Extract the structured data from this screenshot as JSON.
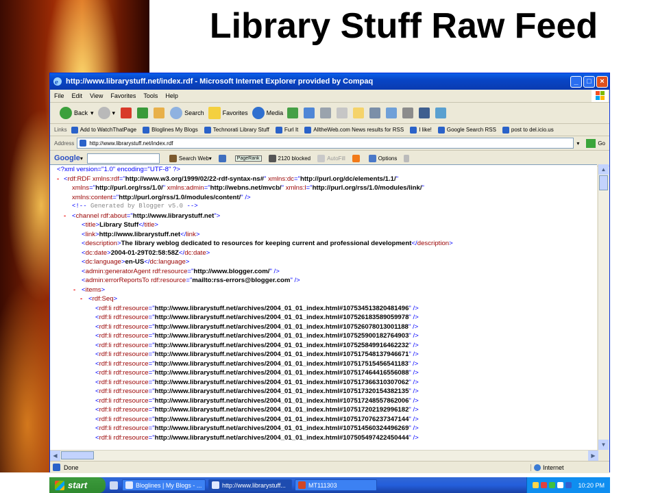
{
  "slide": {
    "title": "Library Stuff Raw Feed"
  },
  "browser": {
    "title": "http://www.librarystuff.net/index.rdf - Microsoft Internet Explorer provided by Compaq",
    "menu": [
      "File",
      "Edit",
      "View",
      "Favorites",
      "Tools",
      "Help"
    ],
    "toolbar": {
      "back": "Back",
      "search": "Search",
      "favorites": "Favorites",
      "media": "Media"
    },
    "links_label": "Links",
    "links": [
      "Add to WatchThatPage",
      "Bloglines My Blogs",
      "Technorati Library Stuff",
      "Furl It",
      "AlltheWeb.com News results for RSS",
      "I like!",
      "Google Search RSS",
      "post to del.icio.us"
    ],
    "address_label": "Address",
    "address": "http://www.librarystuff.net/index.rdf",
    "go_label": "Go",
    "google": {
      "logo": "Google",
      "search_web": "Search Web",
      "pagerank": "PageRank",
      "blocked": "2120 blocked",
      "autofill": "AutoFill",
      "options": "Options"
    },
    "status": {
      "text": "Done",
      "zone": "Internet"
    }
  },
  "xml": {
    "decl": "<?xml version=\"1.0\" encoding=\"UTF-8\" ?>",
    "rdf_ns1": "http://www.w3.org/1999/02/22-rdf-syntax-ns#",
    "dc_ns": "http://purl.org/dc/elements/1.1/",
    "rss_ns": "http://purl.org/rss/1.0/",
    "admin_ns": "http://webns.net/mvcb/",
    "link_ns": "http://purl.org/rss/1.0/modules/link/",
    "content_ns": "http://purl.org/rss/1.0/modules/content/",
    "comment": "Generated by Blogger v5.0",
    "channel_about": "http://www.librarystuff.net",
    "title": "Library Stuff",
    "link": "http://www.librarystuff.net",
    "description": "The library weblog dedicated to resources for keeping current and professional development",
    "date": "2004-01-29T02:58:58Z",
    "language": "en-US",
    "generator": "http://www.blogger.com/",
    "error_reports": "mailto:rss-errors@blogger.com",
    "resources": [
      "http://www.librarystuff.net/archives/2004_01_01_index.html#107534513820481496",
      "http://www.librarystuff.net/archives/2004_01_01_index.html#107526183589059978",
      "http://www.librarystuff.net/archives/2004_01_01_index.html#107526078013001188",
      "http://www.librarystuff.net/archives/2004_01_01_index.html#107525900182764903",
      "http://www.librarystuff.net/archives/2004_01_01_index.html#107525849916462232",
      "http://www.librarystuff.net/archives/2004_01_01_index.html#107517548137946671",
      "http://www.librarystuff.net/archives/2004_01_01_index.html#107517515456541183",
      "http://www.librarystuff.net/archives/2004_01_01_index.html#107517464416556088",
      "http://www.librarystuff.net/archives/2004_01_01_index.html#107517366310307062",
      "http://www.librarystuff.net/archives/2004_01_01_index.html#107517320154382135",
      "http://www.librarystuff.net/archives/2004_01_01_index.html#107517248557862006",
      "http://www.librarystuff.net/archives/2004_01_01_index.html#107517202192996182",
      "http://www.librarystuff.net/archives/2004_01_01_index.html#107517076237347144",
      "http://www.librarystuff.net/archives/2004_01_01_index.html#107514560324496269",
      "http://www.librarystuff.net/archives/2004_01_01_index.html#107505497422450444"
    ]
  },
  "taskbar": {
    "start": "start",
    "tasks": [
      "Bloglines | My Blogs - ...",
      "http://www.librarystuff...",
      "MT111303"
    ],
    "clock": "10:20 PM"
  }
}
